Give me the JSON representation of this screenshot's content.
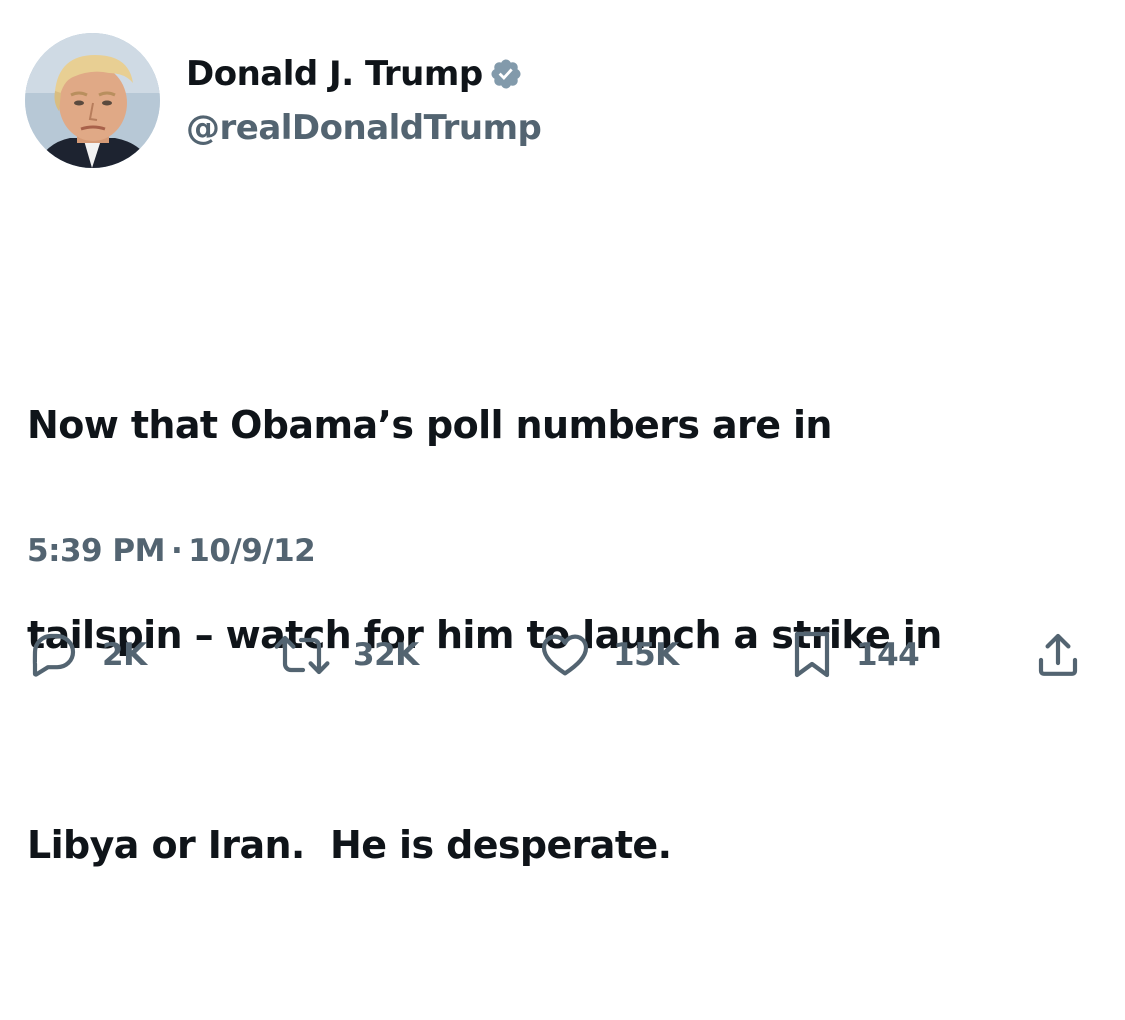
{
  "author": {
    "display_name": "Donald J. Trump",
    "handle": "@realDonaldTrump",
    "verified": true,
    "verified_icon": "verified-badge-icon",
    "avatar_icon": "profile-photo"
  },
  "tweet": {
    "lines": [
      "Now that Obama’s poll numbers are in",
      "tailspin – watch for him to launch a strike in",
      "Libya or Iran.  He is desperate."
    ]
  },
  "meta": {
    "time": "5:39 PM",
    "separator": "·",
    "date": "10/9/12"
  },
  "actions": {
    "reply": {
      "icon": "reply-icon",
      "count": "2K"
    },
    "retweet": {
      "icon": "retweet-icon",
      "count": "32K"
    },
    "like": {
      "icon": "heart-icon",
      "count": "15K"
    },
    "bookmark": {
      "icon": "bookmark-icon",
      "count": "144"
    },
    "share": {
      "icon": "share-icon"
    }
  },
  "colors": {
    "text_primary": "#0f1419",
    "text_secondary": "#536471",
    "verified_badge": "#829aab",
    "background": "#ffffff"
  }
}
